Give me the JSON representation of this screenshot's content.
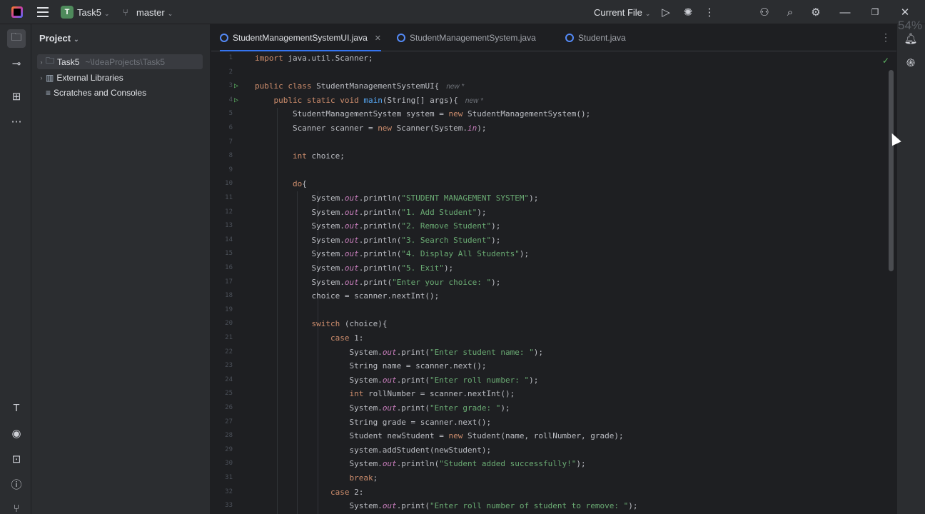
{
  "titlebar": {
    "project_badge": "T",
    "project_name": "Task5",
    "branch": "master",
    "run_config": "Current File"
  },
  "project_panel": {
    "title": "Project",
    "tree": [
      {
        "label": "Task5",
        "path": "~\\IdeaProjects\\Task5"
      },
      {
        "label": "External Libraries"
      },
      {
        "label": "Scratches and Consoles"
      }
    ]
  },
  "tabs": [
    {
      "label": "StudentManagementSystemUI.java",
      "active": true
    },
    {
      "label": "StudentManagementSystem.java",
      "active": false
    },
    {
      "label": "Student.java",
      "active": false
    }
  ],
  "editor": {
    "lines": [
      {
        "n": "1",
        "text": "import java.util.Scanner;"
      },
      {
        "n": "2",
        "text": ""
      },
      {
        "n": "3",
        "text": "public class StudentManagementSystemUI{",
        "hint": "new *"
      },
      {
        "n": "4",
        "text": "    public static void main(String[] args){",
        "hint": "new *"
      },
      {
        "n": "5",
        "text": "        StudentManagementSystem system = new StudentManagementSystem();"
      },
      {
        "n": "6",
        "text": "        Scanner scanner = new Scanner(System.in);"
      },
      {
        "n": "7",
        "text": ""
      },
      {
        "n": "8",
        "text": "        int choice;"
      },
      {
        "n": "9",
        "text": ""
      },
      {
        "n": "10",
        "text": "        do{"
      },
      {
        "n": "11",
        "text": "            System.out.println(\"STUDENT MANAGEMENT SYSTEM\");"
      },
      {
        "n": "12",
        "text": "            System.out.println(\"1. Add Student\");"
      },
      {
        "n": "13",
        "text": "            System.out.println(\"2. Remove Student\");"
      },
      {
        "n": "14",
        "text": "            System.out.println(\"3. Search Student\");"
      },
      {
        "n": "15",
        "text": "            System.out.println(\"4. Display All Students\");"
      },
      {
        "n": "16",
        "text": "            System.out.println(\"5. Exit\");"
      },
      {
        "n": "17",
        "text": "            System.out.print(\"Enter your choice: \");"
      },
      {
        "n": "18",
        "text": "            choice = scanner.nextInt();"
      },
      {
        "n": "19",
        "text": ""
      },
      {
        "n": "20",
        "text": "            switch (choice){"
      },
      {
        "n": "21",
        "text": "                case 1:"
      },
      {
        "n": "22",
        "text": "                    System.out.print(\"Enter student name: \");"
      },
      {
        "n": "23",
        "text": "                    String name = scanner.next();"
      },
      {
        "n": "24",
        "text": "                    System.out.print(\"Enter roll number: \");"
      },
      {
        "n": "25",
        "text": "                    int rollNumber = scanner.nextInt();"
      },
      {
        "n": "26",
        "text": "                    System.out.print(\"Enter grade: \");"
      },
      {
        "n": "27",
        "text": "                    String grade = scanner.next();"
      },
      {
        "n": "28",
        "text": "                    Student newStudent = new Student(name, rollNumber, grade);"
      },
      {
        "n": "29",
        "text": "                    system.addStudent(newStudent);"
      },
      {
        "n": "30",
        "text": "                    System.out.println(\"Student added successfully!\");"
      },
      {
        "n": "31",
        "text": "                    break;"
      },
      {
        "n": "32",
        "text": "                case 2:"
      },
      {
        "n": "33",
        "text": "                    System.out.print(\"Enter roll number of student to remove: \");"
      }
    ]
  },
  "overlay": {
    "percent": "54%"
  },
  "colors": {
    "background": "#1e1f22",
    "panel": "#2b2d30",
    "accent": "#3574f0",
    "keyword": "#cf8e6d",
    "string": "#6aab73",
    "field": "#c77dbb",
    "method": "#56a8f5",
    "number": "#2aacb8"
  }
}
